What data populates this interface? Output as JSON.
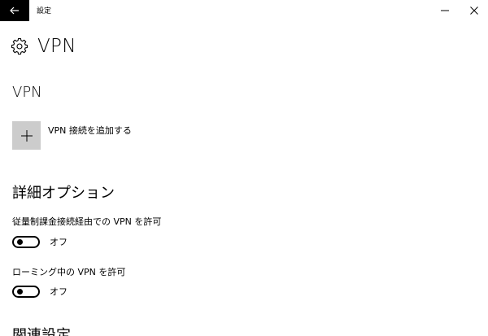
{
  "window": {
    "title": "設定",
    "back_icon": "arrow-left-icon",
    "minimize_icon": "minimize-icon",
    "close_icon": "close-icon"
  },
  "page": {
    "icon": "gear-icon",
    "title": "VPN"
  },
  "vpn_section": {
    "title": "VPN",
    "add_icon": "plus-icon",
    "add_label": "VPN 接続を追加する"
  },
  "advanced_section": {
    "title": "詳細オプション",
    "options": [
      {
        "label": "従量制課金接続経由での VPN を許可",
        "state": "オフ",
        "on": false
      },
      {
        "label": "ローミング中の VPN を許可",
        "state": "オフ",
        "on": false
      }
    ]
  },
  "related_section": {
    "title": "関連設定"
  },
  "colors": {
    "back_button_bg": "#000000",
    "add_tile_bg": "#cccccc",
    "text": "#000000",
    "background": "#ffffff"
  }
}
